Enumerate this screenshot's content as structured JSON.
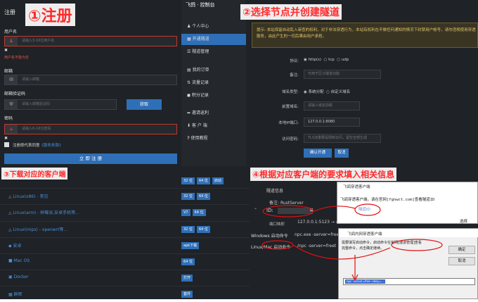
{
  "captions": {
    "c1": "①注册",
    "c2": "②选择节点并创建隧道",
    "c3": "③下载对应的客户端",
    "c4": "④根据对应客户端的要求填入相关信息"
  },
  "register": {
    "brand": "注册",
    "username_label": "用户名",
    "username_placeholder": "请输入3-16位用户名",
    "username_error": "用户名不能为空",
    "email_label": "邮箱",
    "email_placeholder": "请输入邮箱",
    "code_label": "邮箱验证码",
    "code_placeholder": "请输入邮箱验证码",
    "code_button": "获取",
    "password_label": "密码",
    "password_placeholder": "请输入6-16位密码",
    "agree_text": "注册即代表同意",
    "terms_link": "《服务条款》",
    "submit": "立 即 注 册"
  },
  "console": {
    "title": "飞鸽 · 控制台",
    "nav": [
      {
        "label": "个人中心",
        "icon": "user-icon"
      },
      {
        "label": "开通隧道",
        "icon": "grid-icon",
        "active": true
      },
      {
        "label": "隧道管理",
        "icon": "list-icon"
      },
      {
        "label": "我的订单",
        "icon": "order-icon"
      },
      {
        "label": "流量记录",
        "icon": "transfer-icon"
      },
      {
        "label": "积分记录",
        "icon": "points-icon"
      },
      {
        "label": "邀请返利",
        "icon": "share-icon"
      },
      {
        "label": "客 户 端",
        "icon": "client-icon"
      },
      {
        "label": "使用教程",
        "icon": "help-icon"
      }
    ]
  },
  "tunnel_form": {
    "notice": "提示: 本站保留自动乱入审查的权利，对于非法穿透行为，本站有权利在不做任何通知的情况下封禁用户帐号，请勿违规使用穿透服务，由此产生的一切后果由用户承担。",
    "protocol_label": "协议:",
    "protocols": [
      "http(s)",
      "tcp",
      "udp"
    ],
    "remark_label": "备注:",
    "remark_placeholder": "可用于区分隧道功能",
    "domain_type_label": "域名类型:",
    "domain_types": [
      "系统分配",
      "自定义域名"
    ],
    "prefix_label": "前置域名:",
    "prefix_placeholder": "请输入域名前缀",
    "local_label": "本地IP端口:",
    "local_value": "127.0.0.1:8080",
    "password_label": "访问密码:",
    "password_placeholder": "TLS流量要是限制访问，留空全部生成",
    "confirm": "确认开通",
    "cancel": "取消"
  },
  "downloads": {
    "rows": [
      {
        "name": "Linux(x86) - 常见",
        "buttons": [
          "32 位",
          "64 位",
          "启动"
        ]
      },
      {
        "name": "Linux(arm) - 树莓派,安卓手机等...",
        "buttons": [
          "V7",
          "64 位"
        ]
      },
      {
        "name": "Linux(mips) - openwrt等...",
        "buttons": [
          "32 位",
          "64 位"
        ]
      },
      {
        "name": "安卓",
        "buttons": [
          "apk下载"
        ]
      },
      {
        "name": "Mac OS",
        "buttons": [
          "64 位"
        ]
      },
      {
        "name": "Docker",
        "buttons": [
          "打开"
        ]
      },
      {
        "name": "群晖",
        "buttons": [
          "套件"
        ]
      }
    ],
    "top_buttons": [
      "32 位",
      "64 位",
      "启动"
    ]
  },
  "tunnel_info": {
    "header": "隧道信息",
    "remark_label": "备注:",
    "remark_value": "RustServer",
    "id_label": "ID:",
    "port_label": "端口映射",
    "port_value": "127.0.0.1:5123 → 4...",
    "win_label": "Windows 启动命令",
    "win_value": "npc.exe -server=free",
    "linux_label": "Linux/Mac 启动命令",
    "linux_value": "./npc -server=freet",
    "dialog1_title": "飞鸽穿透客户端",
    "dialog1_text": "飞鸽穿透客户端，请在官网[fgnwct.com]查看隧道ID",
    "dialog1_link": "隧道ID",
    "dialog1_choose": "选择",
    "dialog2_title": "飞鸽内网穿透客户端",
    "dialog2_text": "需要填写启动命令，启动命令在官网[隧道管理]查看",
    "dialog2_text2": "完整命令，点击确定继续。",
    "dialog2_ok": "确定",
    "dialog2_cancel": "取消",
    "dialog2_input": "npc -server=free -vkey=..."
  }
}
